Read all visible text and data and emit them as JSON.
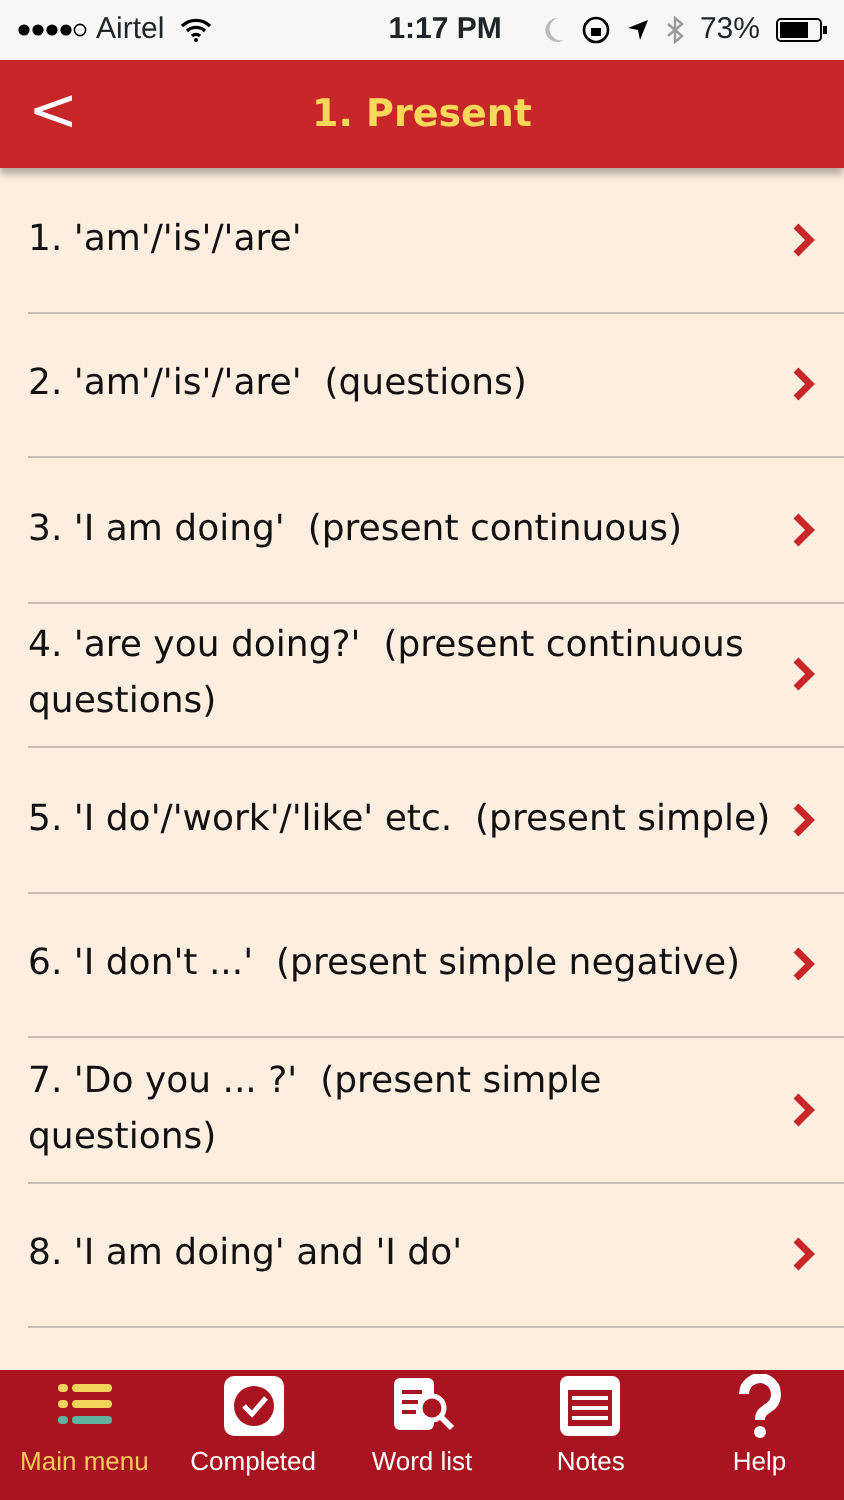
{
  "status_bar": {
    "carrier": "Airtel",
    "time": "1:17 PM",
    "battery": "73%"
  },
  "header": {
    "title": "1. Present",
    "back": "<"
  },
  "items": [
    {
      "text": "1. 'am'/'is'/'are'"
    },
    {
      "text": "2. 'am'/'is'/'are'  (questions)"
    },
    {
      "text": "3. 'I am doing'  (present continuous)"
    },
    {
      "text": "4. 'are you doing?'  (present continuous questions)"
    },
    {
      "text": "5. 'I do'/'work'/'like' etc.  (present simple)"
    },
    {
      "text": "6. 'I don't ...'  (present simple negative)"
    },
    {
      "text": "7. 'Do you ... ?'  (present simple questions)"
    },
    {
      "text": "8. 'I am doing' and 'I do'"
    }
  ],
  "tabs": [
    {
      "label": "Main menu",
      "kind": "menu",
      "selected": true
    },
    {
      "label": "Completed",
      "kind": "completed",
      "selected": false
    },
    {
      "label": "Word list",
      "kind": "wordlist",
      "selected": false
    },
    {
      "label": "Notes",
      "kind": "notes",
      "selected": false
    },
    {
      "label": "Help",
      "kind": "help",
      "selected": false
    }
  ]
}
